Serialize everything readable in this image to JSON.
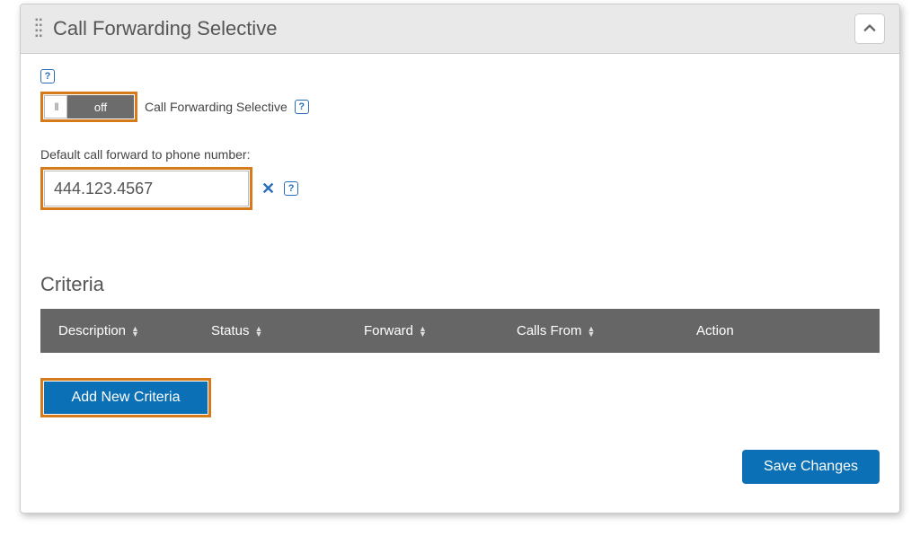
{
  "header": {
    "title": "Call Forwarding Selective"
  },
  "toggle": {
    "state_label": "off",
    "feature_label": "Call Forwarding Selective"
  },
  "forward_number": {
    "label": "Default call forward to phone number:",
    "value": "444.123.4567"
  },
  "criteria": {
    "heading": "Criteria",
    "columns": {
      "description": "Description",
      "status": "Status",
      "forward": "Forward",
      "calls_from": "Calls From",
      "action": "Action"
    }
  },
  "buttons": {
    "add_criteria": "Add New Criteria",
    "save": "Save Changes"
  }
}
